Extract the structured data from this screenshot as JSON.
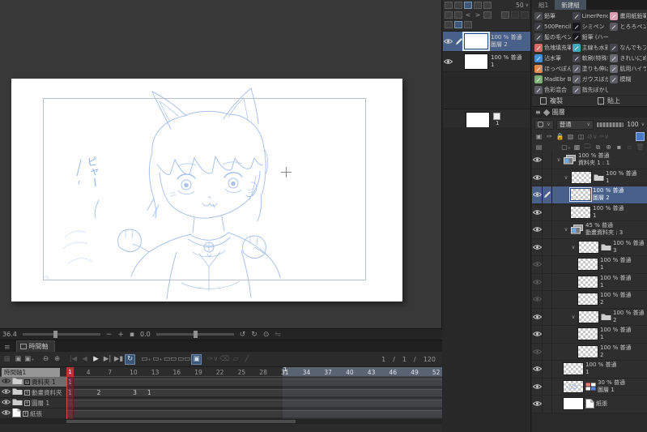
{
  "navbar": {
    "zoom_value": "36.4",
    "rotation_value": "0.0",
    "minus": "−",
    "plus": "+"
  },
  "subtool_panel": {
    "tabs": [
      {
        "label": "組1",
        "active": false
      },
      {
        "label": "新建組",
        "active": true
      }
    ],
    "brush_rows": [
      [
        {
          "label": "鉛筆",
          "color": "#4a4a52"
        },
        {
          "label": "LinerPencil",
          "color": "#44444c"
        },
        {
          "label": "畫用紙鉛筆",
          "color": "#d9a0b4"
        }
      ],
      [
        {
          "label": "500Pencil",
          "color": "#3c3c44"
        },
        {
          "label": "シミペン",
          "color": "#17171c"
        },
        {
          "label": "とろろペン",
          "color": "#5a5a60"
        }
      ],
      [
        {
          "label": "髪の毛ペン",
          "color": "#44444c"
        },
        {
          "label": "鉛筆 (ハー",
          "color": "#17171c"
        },
        null
      ],
      [
        {
          "label": "色塊填充筆",
          "color": "#d96a6a"
        },
        {
          "label": "主線も水彩",
          "color": "#3fa8bc"
        },
        {
          "label": "なんでもブ",
          "color": "#44444c"
        }
      ],
      [
        {
          "label": "沾水筆",
          "color": "#3f8fd9"
        },
        {
          "label": "軟刷(特殊毛)",
          "color": "#44444c"
        },
        {
          "label": "きれいにぬ",
          "color": "#6a6a72"
        }
      ],
      [
        {
          "label": "ほっぺぽん",
          "color": "#e08a50"
        },
        {
          "label": "塗りも伸ば",
          "color": "#5c5c64"
        },
        {
          "label": "肌用ハイラ",
          "color": "#6a6a72"
        }
      ],
      [
        {
          "label": "MadEbr Bru",
          "color": "#7fae78"
        },
        {
          "label": "ガウスぼか",
          "color": "#5c5c64"
        },
        {
          "label": "模糊",
          "color": "#5c5c64"
        }
      ],
      [
        {
          "label": "色彩混合",
          "color": "#5c5c64"
        },
        {
          "label": "指先ぼかし",
          "color": "#5c5c64"
        },
        null
      ]
    ],
    "copy_button": "複製",
    "paste_button": "貼上"
  },
  "mini_layer_panel": {
    "onion_opacity_value": "50",
    "rows": [
      {
        "opacity": "100 % 普通",
        "name": "圖層 2",
        "selected": true,
        "pencil": true
      },
      {
        "opacity": "100 % 普通",
        "name": "1",
        "selected": false,
        "pencil": false
      }
    ],
    "bottom_item_label": "1"
  },
  "layer_panel": {
    "title": "圖層",
    "blend_mode": "普通",
    "opacity_value": "100",
    "rows": [
      {
        "indent": 0,
        "eye": "on",
        "expand": true,
        "icon": "anim-folder",
        "thumb": null,
        "pencil": false,
        "opacity": "100 % 普通",
        "name": "資料夾 1 : 1",
        "selected": false
      },
      {
        "indent": 1,
        "eye": "on",
        "expand": true,
        "icon": "folder",
        "thumb": "checker",
        "pencil": false,
        "opacity": "100 % 普通",
        "name": "1",
        "selected": false
      },
      {
        "indent": 2,
        "eye": "on",
        "expand": false,
        "icon": null,
        "thumb": "checker",
        "pencil": true,
        "opacity": "100 % 普通",
        "name": "圖層 2",
        "selected": true
      },
      {
        "indent": 2,
        "eye": "on",
        "expand": false,
        "icon": null,
        "thumb": "checker",
        "pencil": false,
        "opacity": "100 % 普通",
        "name": "1",
        "selected": false
      },
      {
        "indent": 1,
        "eye": "on",
        "expand": true,
        "icon": "anim-folder",
        "thumb": null,
        "pencil": false,
        "opacity": "45 % 普通",
        "name": "動畫資料夾 : 3",
        "selected": false
      },
      {
        "indent": 2,
        "eye": "on",
        "expand": true,
        "icon": "folder",
        "thumb": "checker",
        "pencil": false,
        "opacity": "100 % 普通",
        "name": "3",
        "selected": false
      },
      {
        "indent": 3,
        "eye": "dim",
        "expand": false,
        "icon": null,
        "thumb": "checker",
        "pencil": false,
        "opacity": "100 % 普通",
        "name": "1",
        "selected": false
      },
      {
        "indent": 3,
        "eye": "dim",
        "expand": false,
        "icon": null,
        "thumb": "checker",
        "pencil": false,
        "opacity": "100 % 普通",
        "name": "1",
        "selected": false
      },
      {
        "indent": 3,
        "eye": "dim",
        "expand": false,
        "icon": null,
        "thumb": "checker",
        "pencil": false,
        "opacity": "100 % 普通",
        "name": "2",
        "selected": false
      },
      {
        "indent": 2,
        "eye": "on",
        "expand": true,
        "icon": "folder",
        "thumb": "checker",
        "pencil": false,
        "opacity": "100 % 普通",
        "name": "2",
        "selected": false
      },
      {
        "indent": 3,
        "eye": "on",
        "expand": false,
        "icon": null,
        "thumb": "checker",
        "pencil": false,
        "opacity": "100 % 普通",
        "name": "1",
        "selected": false
      },
      {
        "indent": 3,
        "eye": "dim",
        "expand": false,
        "icon": null,
        "thumb": "checker",
        "pencil": false,
        "opacity": "100 % 普通",
        "name": "2",
        "selected": false
      },
      {
        "indent": 1,
        "eye": "on",
        "expand": false,
        "icon": null,
        "thumb": "checker",
        "pencil": false,
        "opacity": "100 % 普通",
        "name": "1",
        "selected": false
      },
      {
        "indent": 1,
        "eye": "on",
        "expand": false,
        "icon": "layer-color",
        "thumb": "sketch",
        "pencil": false,
        "opacity": "30 % 普通",
        "name": "圖層 1",
        "selected": false
      },
      {
        "indent": 1,
        "eye": "on",
        "expand": false,
        "icon": "paper",
        "thumb": "white",
        "pencil": false,
        "opacity": "",
        "name": "紙張",
        "selected": false
      }
    ]
  },
  "timeline": {
    "tab_label": "時間軸",
    "timeline_name": "時間軸1",
    "frame_current": "1",
    "frame_start": "1",
    "frame_end": "120",
    "separator": "/",
    "ruler_numbers": [
      4,
      7,
      10,
      13,
      16,
      19,
      22,
      25,
      28,
      31,
      34,
      37,
      40,
      43,
      46,
      49,
      52
    ],
    "highlight_start_frame": 31,
    "second_marker_label": "1",
    "playhead_frame": 1,
    "tracks": [
      {
        "label": "資料夾 1",
        "selected": true,
        "cels": [
          {
            "frame": 1,
            "label": "1"
          }
        ]
      },
      {
        "label": "動畫資料夾",
        "selected": false,
        "cels": [
          {
            "frame": 1,
            "label": "1"
          },
          {
            "frame": 5,
            "label": "2"
          },
          {
            "frame": 10,
            "label": "3"
          },
          {
            "frame": 12,
            "label": "1"
          }
        ]
      },
      {
        "label": "圖層 1",
        "selected": false,
        "cels": []
      },
      {
        "label": "紙張",
        "selected": false,
        "cels": []
      }
    ]
  },
  "sketch": {
    "note_text": "ピャー",
    "line_color": "#aac2ec",
    "accent_color": "#8fb0e8"
  }
}
